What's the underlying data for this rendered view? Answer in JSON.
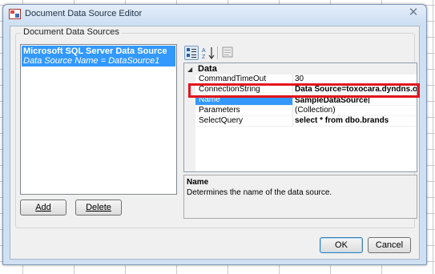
{
  "window": {
    "title": "Document Data Source Editor",
    "icon": "data-source-editor-icon"
  },
  "group": {
    "legend": "Document Data Sources"
  },
  "data_sources": [
    {
      "name": "Microsoft SQL Server Data Source",
      "subtitle": "Data Source Name =  DataSource1"
    }
  ],
  "list_buttons": {
    "add": "Add",
    "delete": "Delete"
  },
  "property_grid": {
    "toolbar": [
      "categorized-icon",
      "alphabetical-sort-icon",
      "property-pages-icon"
    ],
    "category": "Data",
    "properties": [
      {
        "name": "CommandTimeOut",
        "value": "30"
      },
      {
        "name": "ConnectionString",
        "value": "Data Source=toxocara.dyndns.org"
      },
      {
        "name": "Name",
        "value": "SampleDataSource"
      },
      {
        "name": "Parameters",
        "value": "(Collection)"
      },
      {
        "name": "SelectQuery",
        "value": "select * from dbo.brands"
      }
    ],
    "selected_property": "Name"
  },
  "description": {
    "title": "Name",
    "text": "Determines the name of the data source."
  },
  "dialog_buttons": {
    "ok": "OK",
    "cancel": "Cancel"
  },
  "colors": {
    "accent": "#3399ff",
    "highlight": "#e3141d",
    "dialog_frame": "#cfe0f3"
  }
}
